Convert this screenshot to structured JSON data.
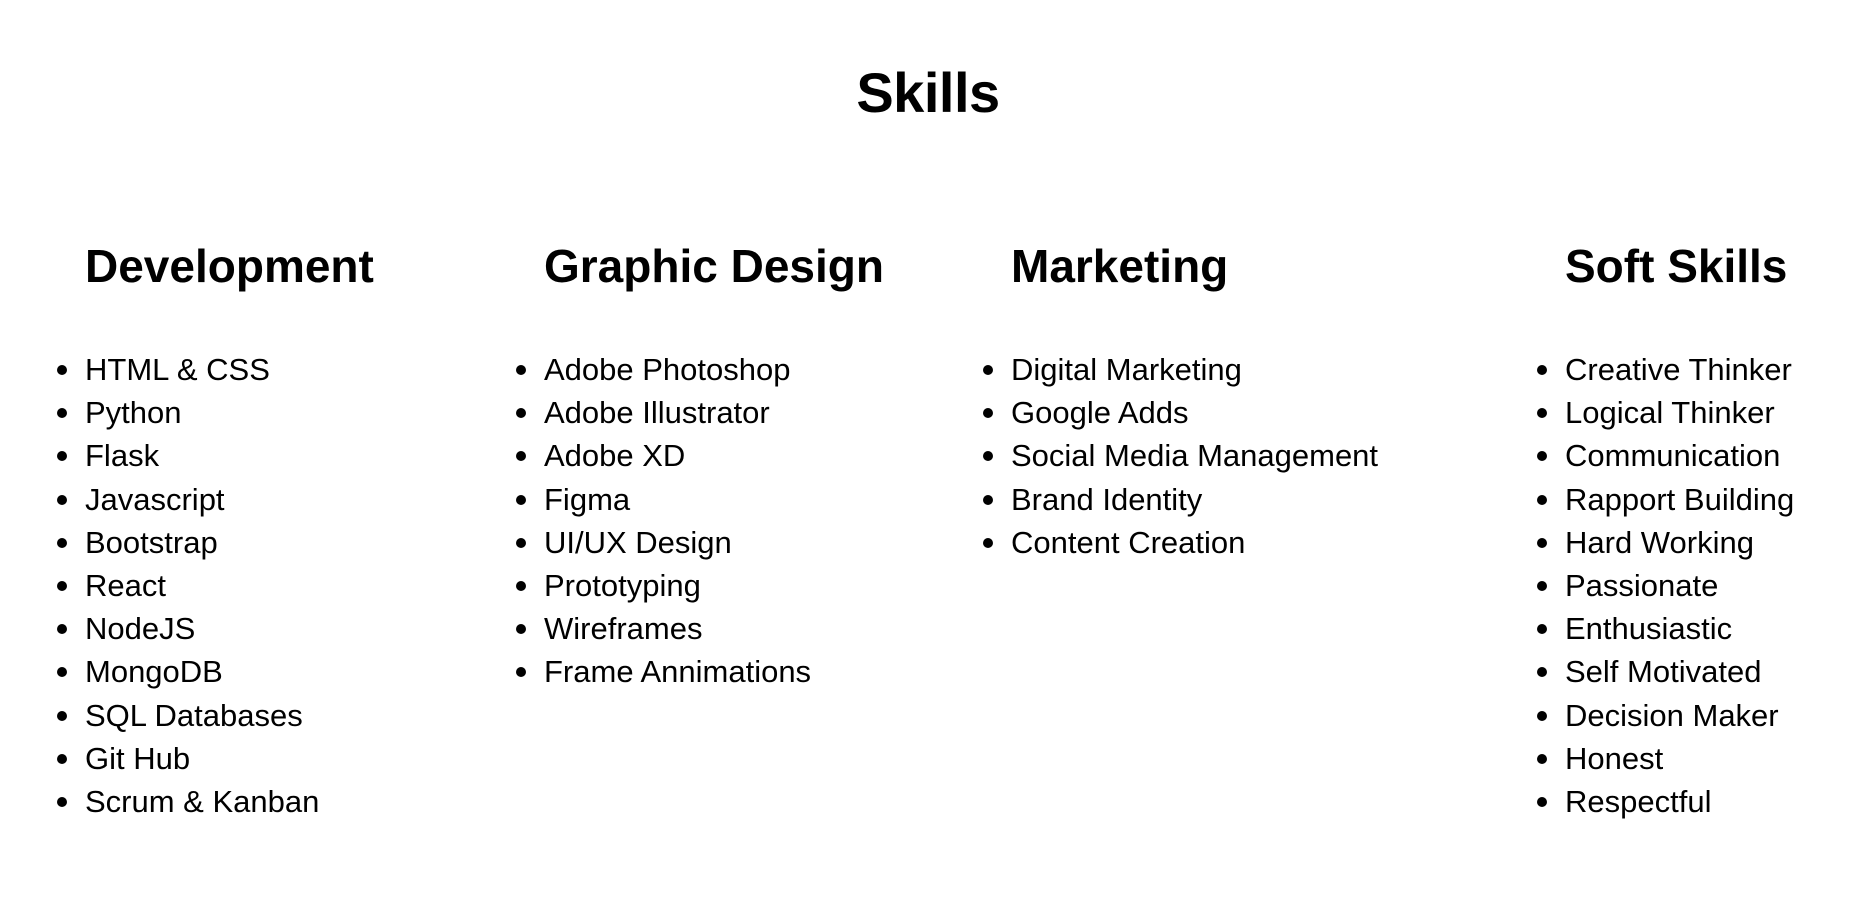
{
  "page": {
    "title": "Skills"
  },
  "columns": [
    {
      "heading": "Development",
      "items": [
        "HTML & CSS",
        "Python",
        "Flask",
        "Javascript",
        "Bootstrap",
        "React",
        "NodeJS",
        "MongoDB",
        "SQL Databases",
        "Git Hub",
        "Scrum & Kanban"
      ]
    },
    {
      "heading": "Graphic Design",
      "items": [
        "Adobe Photoshop",
        "Adobe Illustrator",
        "Adobe XD",
        "Figma",
        "UI/UX Design",
        "Prototyping",
        "Wireframes",
        "Frame Annimations"
      ]
    },
    {
      "heading": "Marketing",
      "items": [
        "Digital Marketing",
        "Google Adds",
        "Social Media Management",
        "Brand Identity",
        "Content Creation"
      ]
    },
    {
      "heading": "Soft Skills",
      "items": [
        "Creative Thinker",
        "Logical Thinker",
        "Communication",
        "Rapport Building",
        "Hard Working",
        "Passionate",
        "Enthusiastic",
        "Self Motivated",
        "Decision Maker",
        "Honest",
        "Respectful"
      ]
    }
  ],
  "colors": {
    "background": "#ffffff",
    "text": "#000000"
  },
  "icons": {
    "bullet": "bullet-dot-icon"
  }
}
